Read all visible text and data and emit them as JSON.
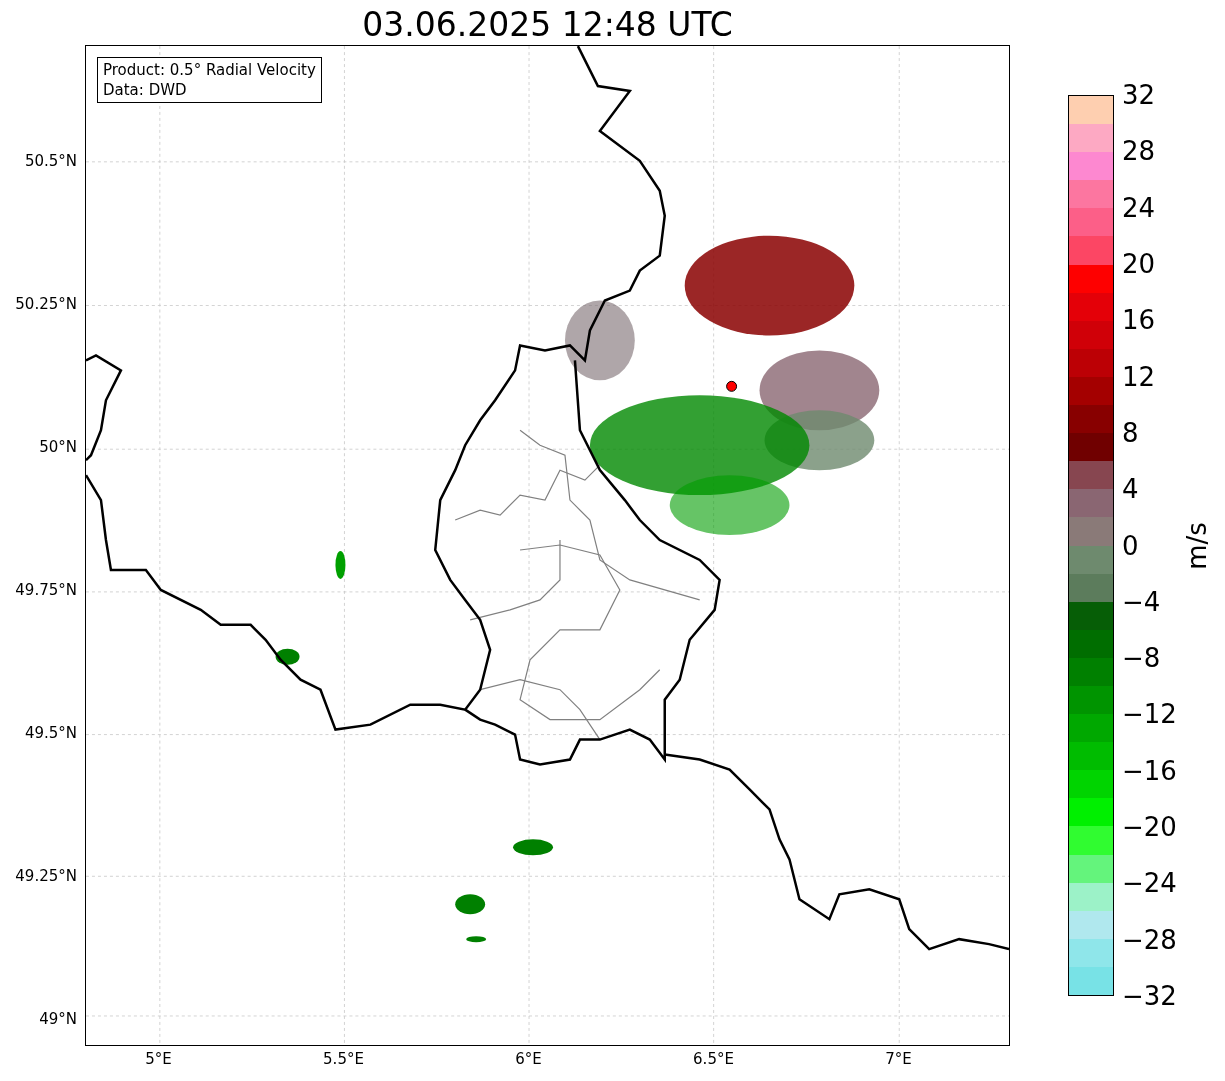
{
  "title": "03.06.2025 12:48 UTC",
  "info_box": {
    "lines": [
      "Product: 0.5° Radial Velocity",
      "Data: DWD"
    ]
  },
  "map": {
    "y_ticks": [
      "50.5°N",
      "50.25°N",
      "50°N",
      "49.75°N",
      "49.5°N",
      "49.25°N",
      "49°N"
    ],
    "x_ticks": [
      "5°E",
      "5.5°E",
      "6°E",
      "6.5°E",
      "7°E"
    ]
  },
  "colorbar": {
    "label": "m/s",
    "ticks": [
      "32",
      "28",
      "24",
      "20",
      "16",
      "12",
      "8",
      "4",
      "0",
      "−4",
      "−8",
      "−12",
      "−16",
      "−20",
      "−24",
      "−28",
      "−32"
    ],
    "segments": [
      {
        "color": "#fecfb0"
      },
      {
        "color": "#fda9c3"
      },
      {
        "color": "#fd88d0"
      },
      {
        "color": "#fc76a0"
      },
      {
        "color": "#fc5f88"
      },
      {
        "color": "#fc4664"
      },
      {
        "color": "#fe0000"
      },
      {
        "color": "#e40008"
      },
      {
        "color": "#d00008"
      },
      {
        "color": "#bc0005"
      },
      {
        "color": "#a40000"
      },
      {
        "color": "#880000"
      },
      {
        "color": "#700000"
      },
      {
        "color": "#874650"
      },
      {
        "color": "#8a6672"
      },
      {
        "color": "#8a7a78"
      },
      {
        "color": "#6e8a6e"
      },
      {
        "color": "#5c7c5c"
      },
      {
        "color": "#065e06"
      },
      {
        "color": "#006e00"
      },
      {
        "color": "#008000"
      },
      {
        "color": "#009400"
      },
      {
        "color": "#00a800"
      },
      {
        "color": "#00bc00"
      },
      {
        "color": "#00d400"
      },
      {
        "color": "#00f000"
      },
      {
        "color": "#30fc30"
      },
      {
        "color": "#64f47c"
      },
      {
        "color": "#9cf2c8"
      },
      {
        "color": "#b0e8ee"
      },
      {
        "color": "#8fe6ea"
      },
      {
        "color": "#78e2e6"
      }
    ]
  }
}
